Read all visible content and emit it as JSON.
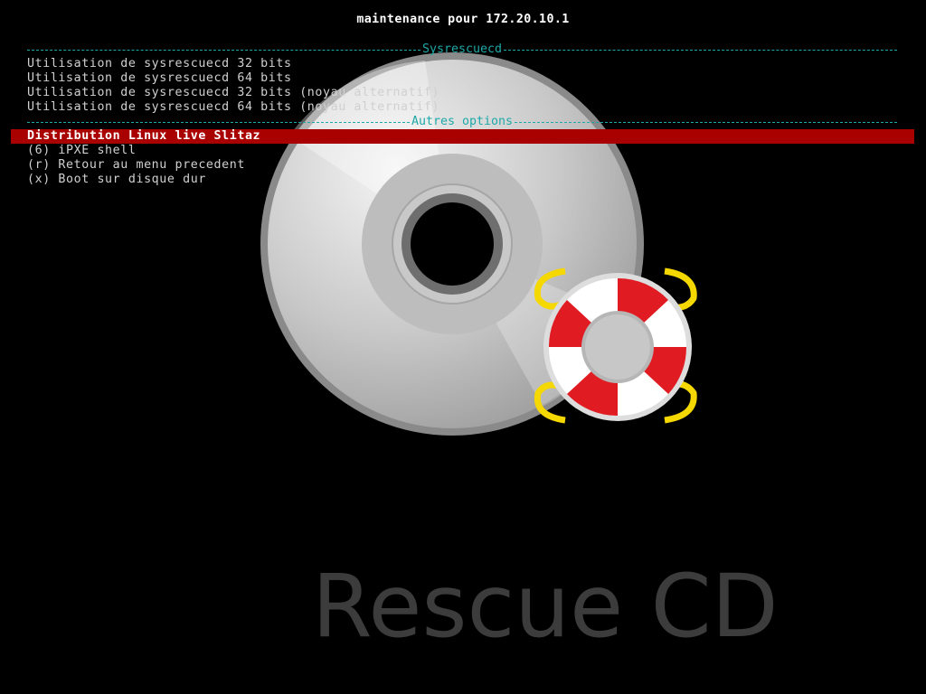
{
  "header": {
    "title": "maintenance pour 172.20.10.1"
  },
  "sections": [
    {
      "label": "Sysrescuecd"
    },
    {
      "label": "Autres options"
    }
  ],
  "menu": {
    "sysrescuecd_items": [
      {
        "label": "Utilisation de sysrescuecd 32 bits"
      },
      {
        "label": "Utilisation de sysrescuecd 64 bits"
      },
      {
        "label": "Utilisation de sysrescuecd 32 bits (noyau alternatif)"
      },
      {
        "label": "Utilisation de sysrescuecd 64 bits (noyau alternatif)"
      }
    ],
    "other_items": [
      {
        "label": "Distribution Linux live Slitaz",
        "selected": true
      },
      {
        "label": "(6) iPXE shell"
      },
      {
        "label": "(r) Retour au menu precedent"
      },
      {
        "label": "(x) Boot sur disque dur"
      }
    ]
  },
  "background": {
    "brand_text": "Rescue CD",
    "icons": [
      "cd-disc-icon",
      "lifebuoy-icon"
    ]
  },
  "colors": {
    "background": "#000000",
    "separator": "#1fa8a8",
    "selection": "#a90000",
    "text": "#d0d0d0",
    "title": "#ffffff"
  }
}
